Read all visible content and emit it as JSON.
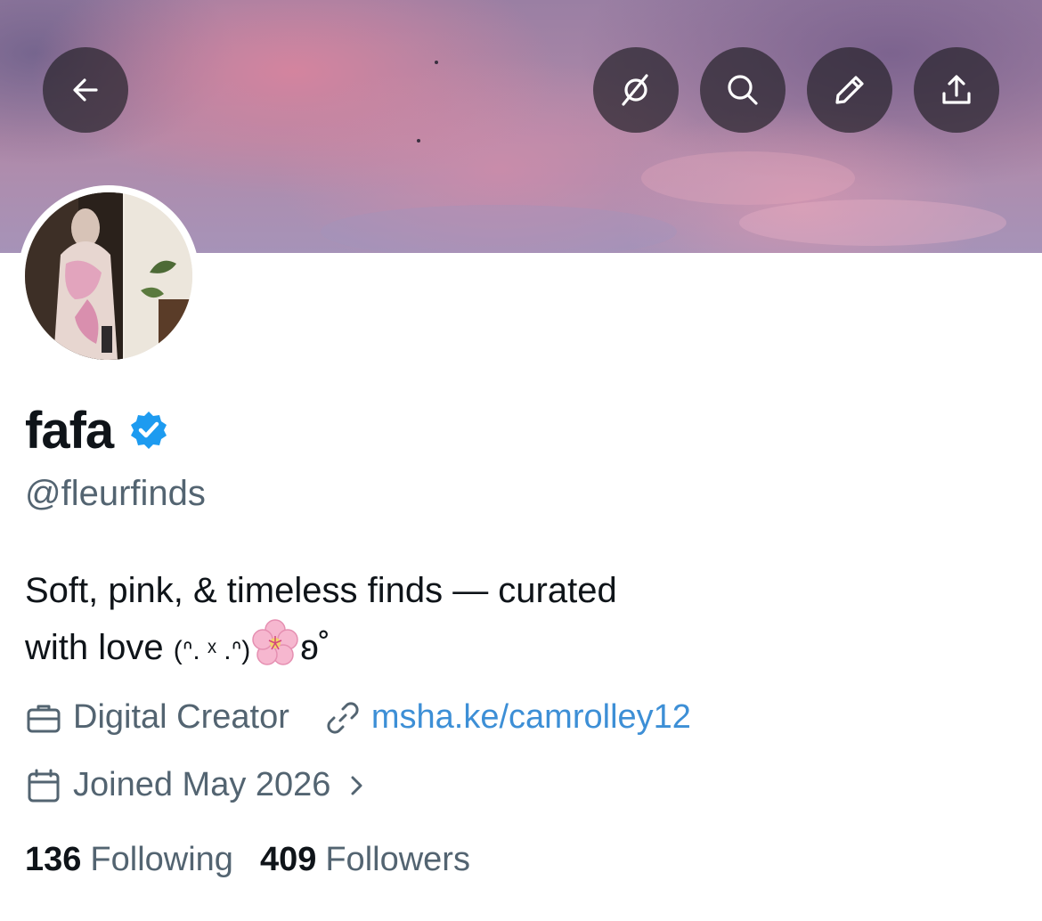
{
  "header": {
    "back_icon": "arrow-left-icon",
    "actions": [
      {
        "name": "grok-icon"
      },
      {
        "name": "search-icon"
      },
      {
        "name": "edit-icon"
      },
      {
        "name": "share-icon"
      }
    ]
  },
  "profile": {
    "display_name": "fafa",
    "verified": true,
    "verified_color": "#1d9bf0",
    "handle": "@fleurfinds",
    "bio_line1": "Soft, pink, & timeless finds — curated",
    "bio_line2_text": "with love ",
    "bio_kaomoji": "(ᐢ. ˣ .ᐢ)",
    "bio_suffix": "ʚ˚",
    "category": "Digital Creator",
    "website": "msha.ke/camrolley12",
    "joined": "Joined May 2026",
    "following_count": "136",
    "following_label": "Following",
    "followers_count": "409",
    "followers_label": "Followers"
  },
  "colors": {
    "text_primary": "#0f1419",
    "text_secondary": "#536471",
    "link": "#3d8fd6"
  }
}
